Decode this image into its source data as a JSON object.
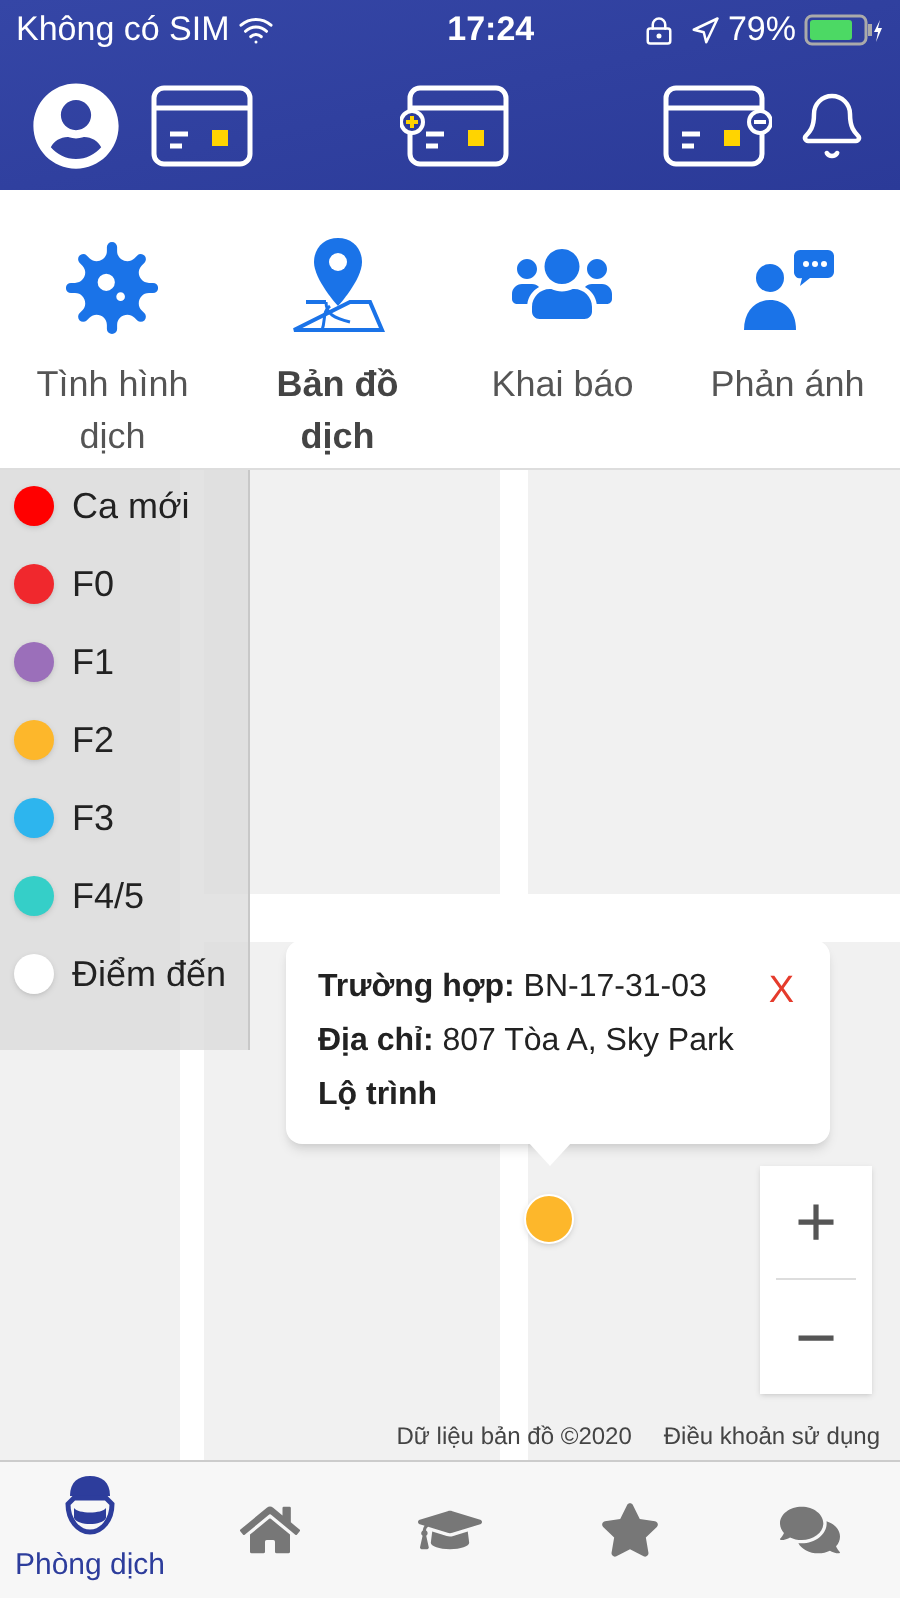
{
  "status_bar": {
    "carrier": "Không có SIM",
    "time": "17:24",
    "battery": "79%"
  },
  "menu": [
    {
      "label": "Tình hình dịch",
      "selected": false
    },
    {
      "label": "Bản đồ dịch",
      "selected": true
    },
    {
      "label": "Khai báo",
      "selected": false
    },
    {
      "label": "Phản ánh",
      "selected": false
    }
  ],
  "legend": [
    {
      "label": "Ca mới",
      "color": "#ff0000"
    },
    {
      "label": "F0",
      "color": "#f0282d"
    },
    {
      "label": "F1",
      "color": "#9b6fba"
    },
    {
      "label": "F2",
      "color": "#fdb72b"
    },
    {
      "label": "F3",
      "color": "#2db5ee"
    },
    {
      "label": "F4/5",
      "color": "#35cfc8"
    },
    {
      "label": "Điểm đến",
      "color": "#ffffff"
    }
  ],
  "popup": {
    "fields": [
      {
        "label": "Trường hợp:",
        "value": "BN-17-31-03"
      },
      {
        "label": "Địa chỉ:",
        "value": "807 Tòa A, Sky Park"
      }
    ],
    "link": "Lộ trình",
    "close": "X"
  },
  "zoom": {
    "plus": "+",
    "minus": "−"
  },
  "attribution": {
    "data": "Dữ liệu bản đồ ©2020",
    "terms": "Điều khoản sử dụng"
  },
  "nav": [
    {
      "label": "Phòng dịch",
      "selected": true
    },
    {
      "selected": false
    },
    {
      "selected": false
    },
    {
      "selected": false
    },
    {
      "selected": false
    }
  ]
}
